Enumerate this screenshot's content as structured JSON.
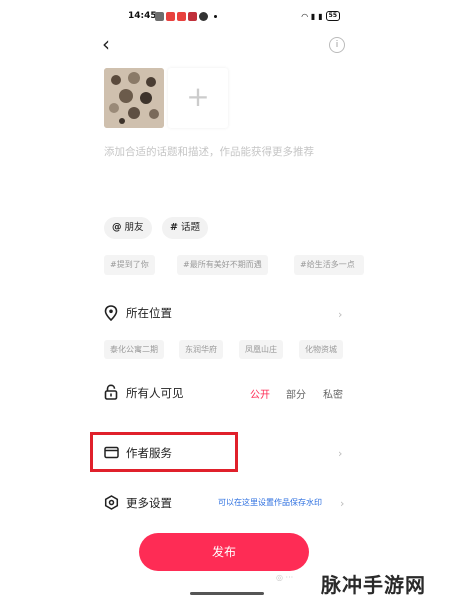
{
  "status_bar": {
    "time": "14:45",
    "battery": "55"
  },
  "description_placeholder": "添加合适的话题和描述，作品能获得更多推荐",
  "chips": [
    {
      "symbol": "@",
      "label": "朋友"
    },
    {
      "symbol": "#",
      "label": "话题"
    }
  ],
  "topic_tags": [
    "#提到了你",
    "#最所有美好不期而遇",
    "#给生活多一点"
  ],
  "location": {
    "label": "所在位置",
    "suggestions": [
      "泰化公寓二期",
      "东润华府",
      "凤凰山庄",
      "化物资城"
    ]
  },
  "visibility": {
    "label": "所有人可见",
    "options": [
      "公开",
      "部分",
      "私密"
    ],
    "selected": "公开"
  },
  "author_services": {
    "label": "作者服务"
  },
  "more_settings": {
    "label": "更多设置",
    "hint": "可以在这里设置作品保存水印"
  },
  "publish_button": "发布",
  "watermark": "脉冲手游网",
  "colors": {
    "accent": "#fe2c55",
    "highlight_box": "#e0202b",
    "hint": "#2c6fe0"
  }
}
